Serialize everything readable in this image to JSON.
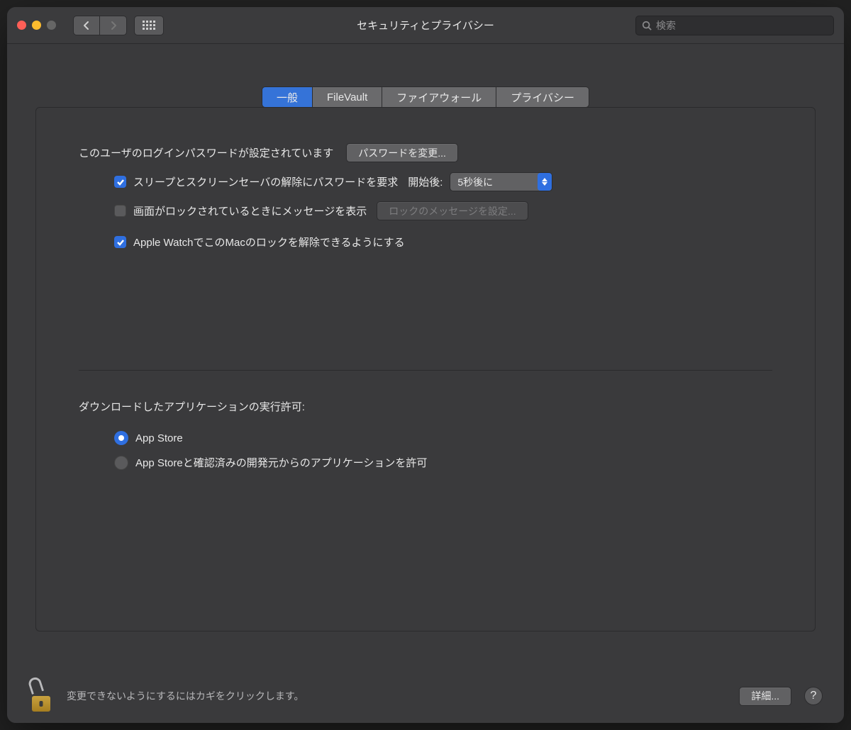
{
  "window": {
    "title": "セキュリティとプライバシー",
    "search_placeholder": "検索"
  },
  "tabs": {
    "general": "一般",
    "filevault": "FileVault",
    "firewall": "ファイアウォール",
    "privacy": "プライバシー"
  },
  "general": {
    "password_set_label": "このユーザのログインパスワードが設定されています",
    "change_password_button": "パスワードを変更...",
    "require_password_label": "スリープとスクリーンセーバの解除にパスワードを要求",
    "after_start_label": "開始後:",
    "delay_select_value": "5秒後に",
    "lock_screen_message_label": "画面がロックされているときにメッセージを表示",
    "set_lock_message_button": "ロックのメッセージを設定...",
    "apple_watch_unlock_label": "Apple WatchでこのMacのロックを解除できるようにする",
    "allow_apps_from_label": "ダウンロードしたアプリケーションの実行許可:",
    "radio_app_store": "App Store",
    "radio_app_store_identified": "App Storeと確認済みの開発元からのアプリケーションを許可"
  },
  "footer": {
    "lock_text": "変更できないようにするにはカギをクリックします。",
    "advanced_button": "詳細...",
    "help_label": "?"
  }
}
